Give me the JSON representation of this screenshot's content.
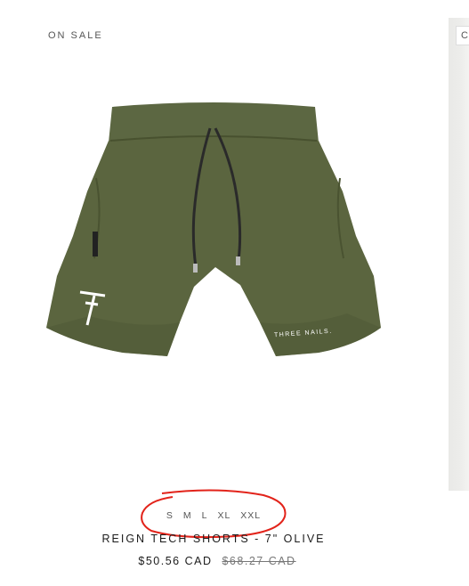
{
  "product": {
    "badge": "ON SALE",
    "title": "REIGN TECH SHORTS - 7\" OLIVE",
    "sale_price": "$50.56 CAD",
    "regular_price": "$68.27 CAD",
    "sizes": [
      "S",
      "M",
      "L",
      "XL",
      "XXL"
    ],
    "image_icon": "olive-shorts-image",
    "colors": {
      "shorts": "#5a6440",
      "annotation": "#e2231a"
    }
  },
  "next_product": {
    "badge": "C"
  }
}
